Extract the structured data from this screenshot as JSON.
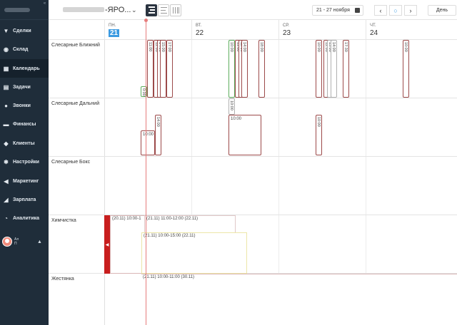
{
  "sidebar": {
    "collapse_glyph": "«",
    "items": [
      {
        "label": "Сделки",
        "icon": "funnel-icon",
        "glyph": "▼"
      },
      {
        "label": "Склад",
        "icon": "box-icon",
        "glyph": "◉"
      },
      {
        "label": "Календарь",
        "icon": "calendar-icon",
        "glyph": "▦",
        "active": true
      },
      {
        "label": "Задачи",
        "icon": "tasks-icon",
        "glyph": "▤"
      },
      {
        "label": "Звонки",
        "icon": "phone-icon",
        "glyph": "●"
      },
      {
        "label": "Финансы",
        "icon": "wallet-icon",
        "glyph": "▬"
      },
      {
        "label": "Клиенты",
        "icon": "users-icon",
        "glyph": "◆"
      },
      {
        "label": "Настройки",
        "icon": "gear-icon",
        "glyph": "✱"
      },
      {
        "label": "Маркетинг",
        "icon": "megaphone-icon",
        "glyph": "◀"
      },
      {
        "label": "Зарплата",
        "icon": "money-icon",
        "glyph": "◢"
      },
      {
        "label": "Аналитика",
        "icon": "chart-icon",
        "glyph": "◔"
      }
    ],
    "user": {
      "name": "Ал",
      "sub": "П"
    }
  },
  "topbar": {
    "title_suffix": "-ЯРО...",
    "date_range": "21 - 27 ноября",
    "day_label": "День",
    "prev_glyph": "‹",
    "next_glyph": "›",
    "today_glyph": "○",
    "dropdown_glyph": "⌄"
  },
  "days": [
    {
      "dow": "ПН.",
      "num": "21",
      "today": true
    },
    {
      "dow": "ВТ.",
      "num": "22"
    },
    {
      "dow": "СР.",
      "num": "23"
    },
    {
      "dow": "ЧТ.",
      "num": "24"
    }
  ],
  "resources": [
    "Слесарные Ближний",
    "Слесарные Дальний",
    "Слесарные Бокс",
    "Химчистка",
    "Жестянка"
  ],
  "events": {
    "e1": "0:00",
    "e2": "11:00",
    "e3": "12:00",
    "e4": "14:00",
    "e5": "15:00",
    "e6": "17:00",
    "e7": "10:00",
    "e8": "11:00",
    "e9": "12:00",
    "e10": "14:00",
    "e11": "18:00",
    "e12": "10:00",
    "e13": "12:00",
    "e14": "13:00",
    "e15": "14:00",
    "e16": "17:30",
    "e17": "10:00",
    "d1": "10:00",
    "d2": "14:00",
    "d3": "10:00",
    "d4": "10:00",
    "d5": "10:00",
    "h1": "(20.11) 10:00-1",
    "h2": "(21.11) 11:00-12:00 (22.11)",
    "h3": "(21.11) 10:00-15:00 (22.11)",
    "h4": "(21.11) 10:00-11:00 (30.11)",
    "redtab_glyph": "◀"
  }
}
